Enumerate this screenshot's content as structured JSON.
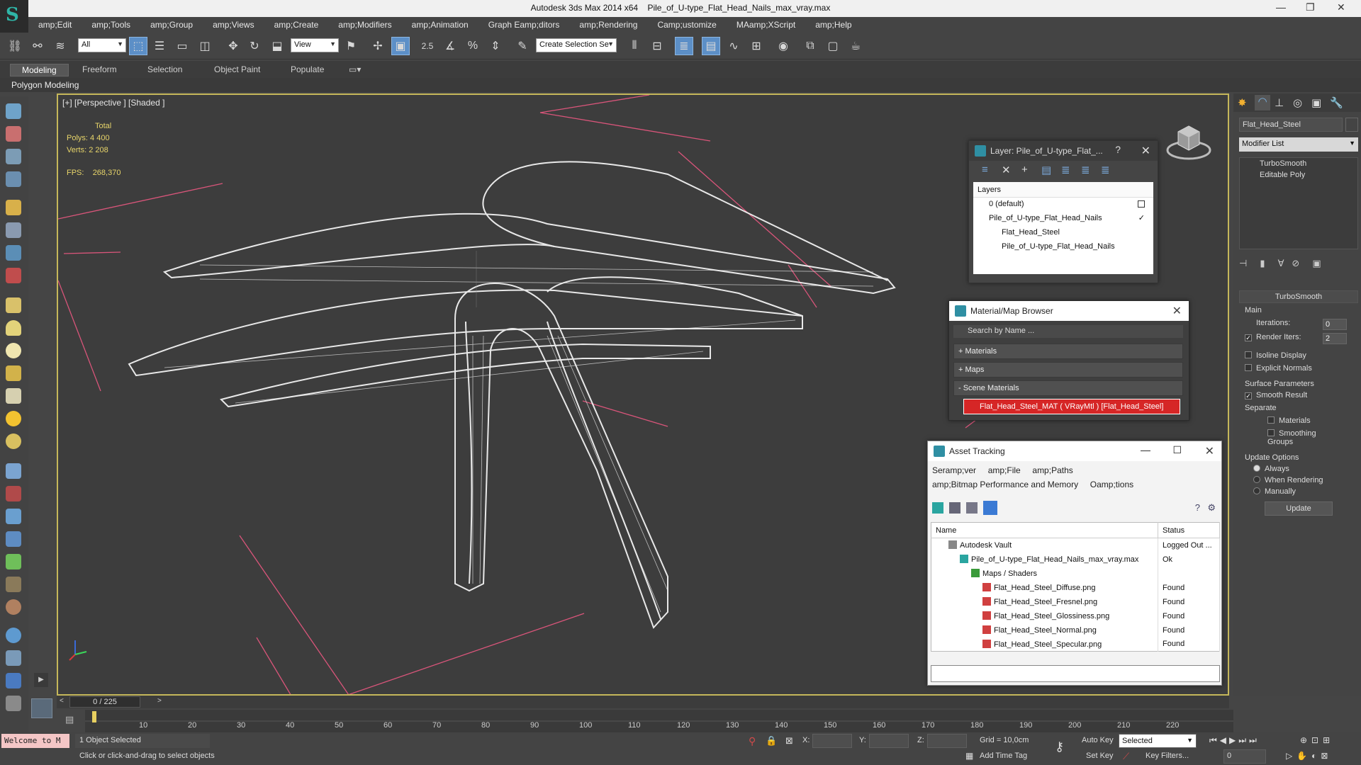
{
  "window": {
    "app": "Autodesk 3ds Max  2014 x64",
    "file": "Pile_of_U-type_Flat_Head_Nails_max_vray.max",
    "minimize": "—",
    "restore": "❐",
    "close": "✕"
  },
  "menu": [
    "amp;Edit",
    "amp;Tools",
    "amp;Group",
    "amp;Views",
    "amp;Create",
    "amp;Modifiers",
    "amp;Animation",
    "Graph Eamp;ditors",
    "amp;Rendering",
    "Camp;ustomize",
    "MAamp;XScript",
    "amp;Help"
  ],
  "toolbar": {
    "selection_filter": "All",
    "ref_coord": "View",
    "snap_angle": "2.5",
    "named_selection": "Create Selection Se"
  },
  "ribbon": {
    "tabs": [
      "Modeling",
      "Freeform",
      "Selection",
      "Object Paint",
      "Populate"
    ],
    "active_tab": "Modeling",
    "sub": "Polygon Modeling"
  },
  "viewport": {
    "label": "[+] [Perspective ] [Shaded ]",
    "stats_header": "Total",
    "polys_label": "Polys:",
    "polys_value": "4 400",
    "verts_label": "Verts:",
    "verts_value": "2 208",
    "fps_label": "FPS:",
    "fps_value": "268,370"
  },
  "layer_panel": {
    "title": "Layer: Pile_of_U-type_Flat_...",
    "help": "?",
    "close": "✕",
    "header": "Layers",
    "rows": [
      {
        "label": "0 (default)",
        "indent": 1
      },
      {
        "label": "Pile_of_U-type_Flat_Head_Nails",
        "indent": 1
      },
      {
        "label": "Flat_Head_Steel",
        "indent": 2
      },
      {
        "label": "Pile_of_U-type_Flat_Head_Nails",
        "indent": 2
      }
    ]
  },
  "material_browser": {
    "title": "Material/Map Browser",
    "close": "✕",
    "search_placeholder": "Search by Name ...",
    "groups": [
      "+ Materials",
      "+ Maps",
      "- Scene Materials"
    ],
    "selected_material": "Flat_Head_Steel_MAT ( VRayMtl ) [Flat_Head_Steel]"
  },
  "asset_tracking": {
    "title": "Asset Tracking",
    "menu_row1": [
      "Seramp;ver",
      "amp;File",
      "amp;Paths"
    ],
    "menu_row2": [
      "amp;Bitmap Performance and Memory",
      "Oamp;tions"
    ],
    "col_name": "Name",
    "col_status": "Status",
    "rows": [
      {
        "name": "Autodesk Vault",
        "status": "Logged Out ..."
      },
      {
        "name": "Pile_of_U-type_Flat_Head_Nails_max_vray.max",
        "status": "Ok"
      },
      {
        "name": "Maps / Shaders",
        "status": ""
      },
      {
        "name": "Flat_Head_Steel_Diffuse.png",
        "status": "Found"
      },
      {
        "name": "Flat_Head_Steel_Fresnel.png",
        "status": "Found"
      },
      {
        "name": "Flat_Head_Steel_Glossiness.png",
        "status": "Found"
      },
      {
        "name": "Flat_Head_Steel_Normal.png",
        "status": "Found"
      },
      {
        "name": "Flat_Head_Steel_Specular.png",
        "status": "Found"
      }
    ]
  },
  "command_panel": {
    "object_name": "Flat_Head_Steel",
    "modifier_list": "Modifier List",
    "stack": [
      "TurboSmooth",
      "Editable Poly"
    ],
    "rollout_title": "TurboSmooth",
    "main_label": "Main",
    "iterations_label": "Iterations:",
    "iterations_value": "0",
    "render_iters_label": "Render Iters:",
    "render_iters_value": "2",
    "isoline": "Isoline Display",
    "explicit_normals": "Explicit Normals",
    "surface_params": "Surface Parameters",
    "smooth_result": "Smooth Result",
    "separate": "Separate",
    "materials": "Materials",
    "smoothing_groups": "Smoothing Groups",
    "update_options": "Update Options",
    "always": "Always",
    "when_rendering": "When Rendering",
    "manually": "Manually",
    "update_button": "Update"
  },
  "timeline": {
    "frame": "0 / 225",
    "ticks": [
      "10",
      "20",
      "30",
      "40",
      "50",
      "60",
      "70",
      "80",
      "90",
      "100",
      "110",
      "120",
      "130",
      "140",
      "150",
      "160",
      "170",
      "180",
      "190",
      "200",
      "210",
      "220"
    ]
  },
  "status": {
    "welcome": "Welcome to M",
    "selected": "1 Object Selected",
    "hint": "Click or click-and-drag to select objects",
    "x_label": "X:",
    "y_label": "Y:",
    "z_label": "Z:",
    "grid": "Grid = 10,0cm",
    "auto_key": "Auto Key",
    "auto_key_sel": "Selected",
    "set_key": "Set Key",
    "key_filters": "Key Filters...",
    "add_time_tag": "Add Time Tag",
    "frame_field": "0"
  },
  "colors": {
    "accent_blue": "#5c8fc7",
    "viewport_border": "#c5b75a",
    "stats_yellow": "#e8d56a",
    "selected_material_red": "#d62626",
    "grid_pink": "#d9557a"
  }
}
